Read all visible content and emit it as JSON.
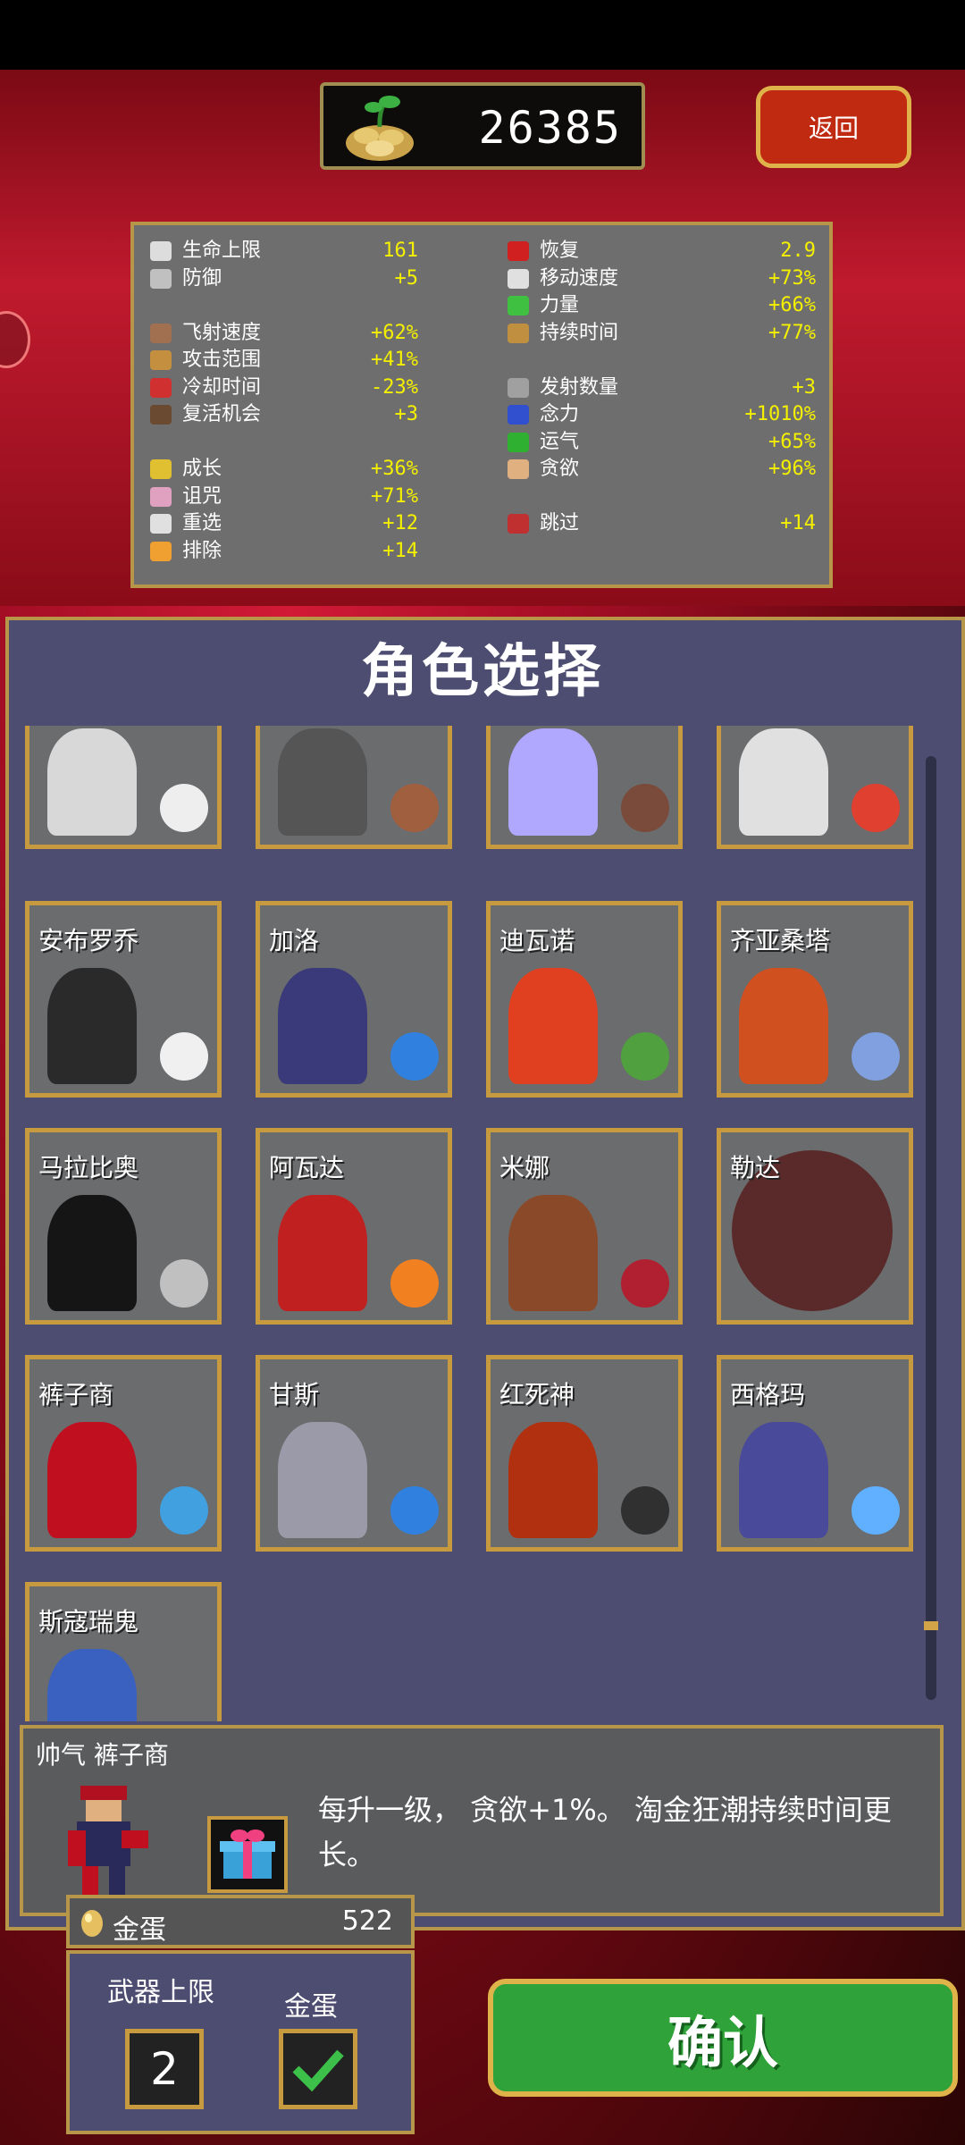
{
  "header": {
    "gold": "26385",
    "back_label": "返回"
  },
  "stats": {
    "left": [
      {
        "name": "生命上限",
        "value": "161",
        "icon": "heart-outline-icon",
        "color": "#dddddd"
      },
      {
        "name": "防御",
        "value": "+5",
        "icon": "armor-icon",
        "color": "#c0c0c0"
      },
      {
        "name": "",
        "value": "",
        "icon": "",
        "color": ""
      },
      {
        "name": "飞射速度",
        "value": "+62%",
        "icon": "projectile-speed-icon",
        "color": "#a07050"
      },
      {
        "name": "攻击范围",
        "value": "+41%",
        "icon": "area-icon",
        "color": "#c49040"
      },
      {
        "name": "冷却时间",
        "value": "-23%",
        "icon": "cooldown-icon",
        "color": "#d03030"
      },
      {
        "name": "复活机会",
        "value": "+3",
        "icon": "revival-icon",
        "color": "#6a4a30"
      },
      {
        "name": "",
        "value": "",
        "icon": "",
        "color": ""
      },
      {
        "name": "成长",
        "value": "+36%",
        "icon": "crown-icon",
        "color": "#e0c030"
      },
      {
        "name": "诅咒",
        "value": "+71%",
        "icon": "skull-icon",
        "color": "#e0a0c0"
      },
      {
        "name": "重选",
        "value": "+12",
        "icon": "reroll-icon",
        "color": "#e0e0e0"
      },
      {
        "name": "排除",
        "value": "+14",
        "icon": "banish-icon",
        "color": "#f0a030"
      }
    ],
    "right": [
      {
        "name": "恢复",
        "value": "2.9",
        "icon": "heart-icon",
        "color": "#d02020"
      },
      {
        "name": "移动速度",
        "value": "+73%",
        "icon": "wing-icon",
        "color": "#e0e0e0"
      },
      {
        "name": "力量",
        "value": "+66%",
        "icon": "leaf-icon",
        "color": "#40c040"
      },
      {
        "name": "持续时间",
        "value": "+77%",
        "icon": "hourglass-icon",
        "color": "#c09040"
      },
      {
        "name": "",
        "value": "",
        "icon": "",
        "color": ""
      },
      {
        "name": "发射数量",
        "value": "+3",
        "icon": "amount-icon",
        "color": "#a0a0a0"
      },
      {
        "name": "念力",
        "value": "+1010%",
        "icon": "orb-icon",
        "color": "#3050d0"
      },
      {
        "name": "运气",
        "value": "+65%",
        "icon": "clover-icon",
        "color": "#30b030"
      },
      {
        "name": "贪欲",
        "value": "+96%",
        "icon": "greed-icon",
        "color": "#e0b080"
      },
      {
        "name": "",
        "value": "",
        "icon": "",
        "color": ""
      },
      {
        "name": "跳过",
        "value": "+14",
        "icon": "skip-icon",
        "color": "#c03030"
      },
      {
        "name": "",
        "value": "",
        "icon": "",
        "color": ""
      }
    ]
  },
  "panel": {
    "title": "角色选择"
  },
  "characters": [
    {
      "name": "",
      "weapon": "bone"
    },
    {
      "name": "",
      "weapon": "rock"
    },
    {
      "name": "",
      "weapon": "wheel"
    },
    {
      "name": "",
      "weapon": "flower"
    },
    {
      "name": "安布罗乔",
      "weapon": "egg"
    },
    {
      "name": "加洛",
      "weapon": "blue-wand"
    },
    {
      "name": "迪瓦诺",
      "weapon": "leaf"
    },
    {
      "name": "齐亚桑塔",
      "weapon": "blue-swirl"
    },
    {
      "name": "马拉比奥",
      "weapon": "knives"
    },
    {
      "name": "阿瓦达",
      "weapon": "fire"
    },
    {
      "name": "米娜",
      "weapon": "red-whip"
    },
    {
      "name": "勒达",
      "weapon": "none"
    },
    {
      "name": "裤子商",
      "weapon": "gift"
    },
    {
      "name": "甘斯",
      "weapon": "blue-wand"
    },
    {
      "name": "红死神",
      "weapon": "scythe"
    },
    {
      "name": "西格玛",
      "weapon": "ice"
    },
    {
      "name": "斯寇瑞鬼",
      "weapon": "none"
    }
  ],
  "selected": {
    "name": "帅气  裤子商",
    "description": "每升一级， 贪欲+1%。 淘金狂潮持续时间更长。"
  },
  "egg": {
    "label": "金蛋",
    "value": "522"
  },
  "options": {
    "weapon_limit_label": "武器上限",
    "weapon_limit_value": "2",
    "egg_label": "金蛋",
    "egg_checked": true
  },
  "confirm_label": "确认"
}
